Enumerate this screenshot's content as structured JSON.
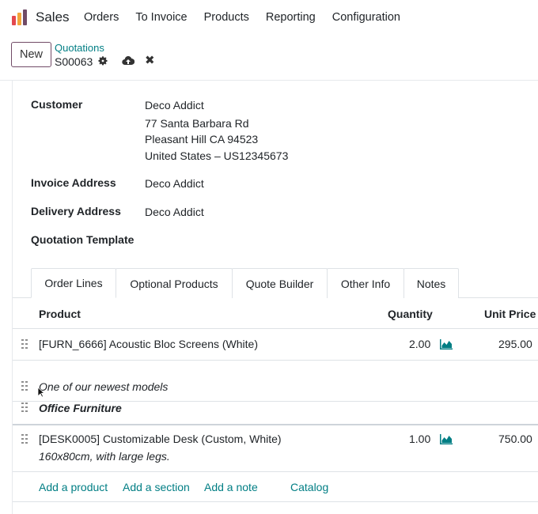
{
  "navbar": {
    "app_name": "Sales",
    "menu": [
      "Orders",
      "To Invoice",
      "Products",
      "Reporting",
      "Configuration"
    ]
  },
  "control_panel": {
    "new_label": "New",
    "breadcrumb_parent": "Quotations",
    "record_name": "S00063"
  },
  "form": {
    "customer_label": "Customer",
    "customer_lines": [
      "Deco Addict",
      "77 Santa Barbara Rd",
      "Pleasant Hill CA 94523",
      "United States – US12345673"
    ],
    "invoice_address_label": "Invoice Address",
    "invoice_address_value": "Deco Addict",
    "delivery_address_label": "Delivery Address",
    "delivery_address_value": "Deco Addict",
    "quotation_template_label": "Quotation Template"
  },
  "tabs": [
    "Order Lines",
    "Optional Products",
    "Quote Builder",
    "Other Info",
    "Notes"
  ],
  "table": {
    "headers": {
      "product": "Product",
      "quantity": "Quantity",
      "unit_price": "Unit Price"
    },
    "lines": [
      {
        "product": "[FURN_6666] Acoustic Bloc Screens (White)",
        "quantity": "2.00",
        "unit_price": "295.00"
      },
      {
        "note": "One of our newest models"
      },
      {
        "section": "Office Furniture"
      },
      {
        "product": "[DESK0005] Customizable Desk (Custom, White)",
        "description": "160x80cm, with large legs.",
        "quantity": "1.00",
        "unit_price": "750.00"
      }
    ],
    "actions": [
      "Add a product",
      "Add a section",
      "Add a note",
      "Catalog"
    ]
  },
  "colors": {
    "brand": "#714b67",
    "link": "#017e84"
  }
}
